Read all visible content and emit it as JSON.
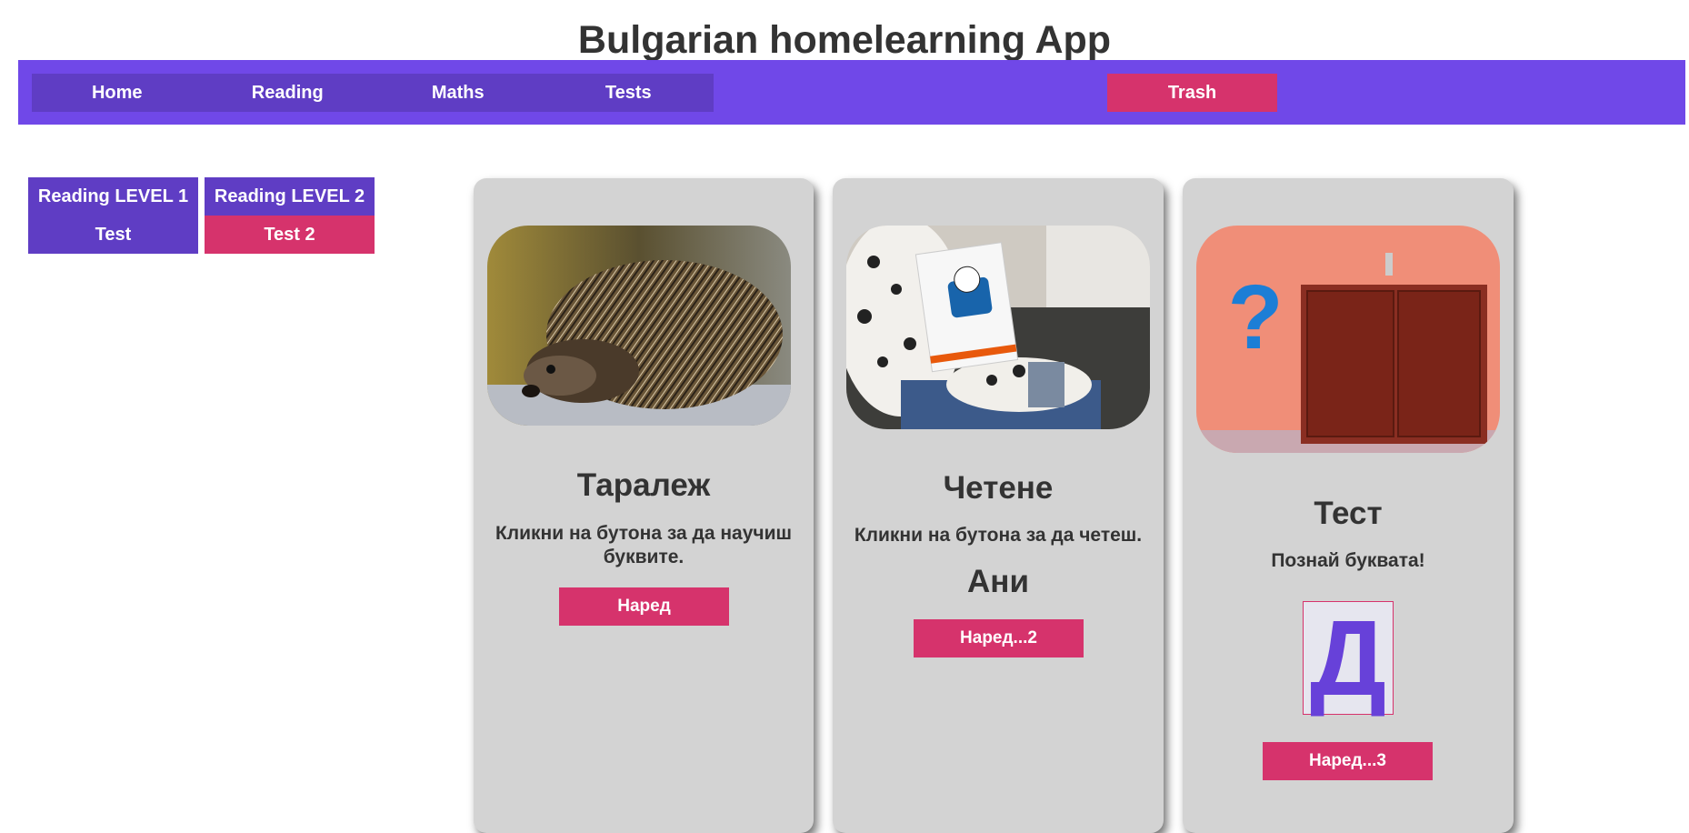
{
  "header": {
    "title": "Bulgarian homelearning App"
  },
  "nav": {
    "items": [
      {
        "label": "Home"
      },
      {
        "label": "Reading"
      },
      {
        "label": "Maths"
      },
      {
        "label": "Tests"
      }
    ],
    "trash_label": "Trash"
  },
  "sidebar": {
    "buttons": [
      {
        "label": "Reading LEVEL 1"
      },
      {
        "label": "Reading LEVEL 2"
      },
      {
        "label": "Test"
      },
      {
        "label": "Test 2"
      }
    ]
  },
  "cards": [
    {
      "title": "Таралеж",
      "text": "Кликни на бутона за да научиш буквите.",
      "button": "Наред",
      "image": "hedgehog-photo"
    },
    {
      "title": "Четене",
      "text": "Кликни на бутона за да четеш.",
      "subtitle": "Ани",
      "button": "Наред...2",
      "image": "child-reading-photo"
    },
    {
      "title": "Тест",
      "text": "Познай буквата!",
      "letter": "Д",
      "button": "Наред...3",
      "image": "door-question-photo"
    }
  ],
  "colors": {
    "navbar": "#7048e8",
    "nav_group": "#5f3dc4",
    "accent_pink": "#d6336c",
    "card_bg": "#d3d3d3",
    "letter": "#6741d9"
  }
}
